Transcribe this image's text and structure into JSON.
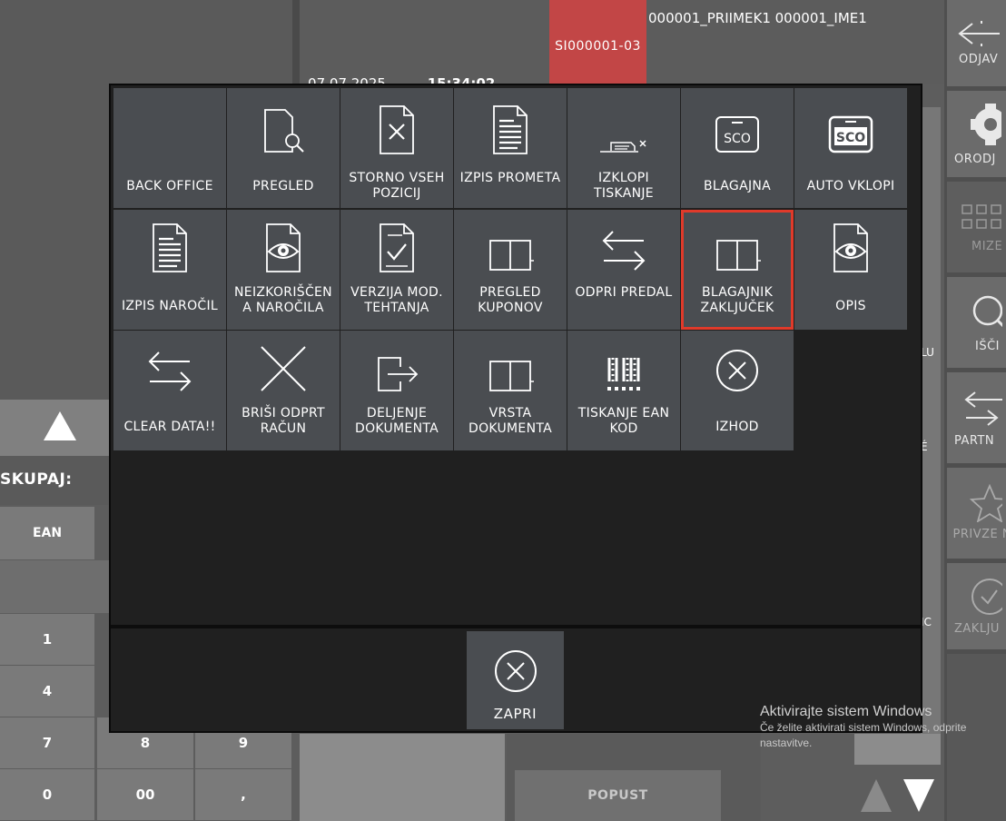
{
  "header": {
    "document_number": "SI000001-03",
    "customer": "000001_PRIIMEK1 000001_IME1",
    "date_partial": "07.07.2025",
    "time_partial": "15:34:02"
  },
  "sidebar_right": [
    {
      "label": "ODJAV",
      "icon": "logout-icon"
    },
    {
      "label": "ORODJ",
      "icon": "gear-icon"
    },
    {
      "label": "MIZE",
      "icon": "grid-icon"
    },
    {
      "label": "IŠČI",
      "icon": "search-icon"
    },
    {
      "label": "PARTN",
      "icon": "swap-arrows-icon"
    },
    {
      "label": "PRIVZE NP",
      "icon": "star-icon"
    },
    {
      "label": "ZAKLJU",
      "icon": "check-circle-icon"
    }
  ],
  "left_panel": {
    "total_label": "SKUPAJ:",
    "ean_label": "EAN",
    "numpad": [
      "1",
      "4",
      "7",
      "8",
      "9",
      "0",
      "00",
      ","
    ]
  },
  "bottom": {
    "discount_label": "POPUST"
  },
  "partial_side_labels": [
    "LU",
    "É",
    "IC"
  ],
  "modal": {
    "tiles": [
      {
        "label": "BACK OFFICE",
        "icon": "none"
      },
      {
        "label": "PREGLED",
        "icon": "document-search-icon"
      },
      {
        "label": "STORNO VSEH POZICIJ",
        "icon": "document-cancel-icon"
      },
      {
        "label": "IZPIS PROMETA",
        "icon": "document-lines-icon"
      },
      {
        "label": "IZKLOPI TISKANJE",
        "icon": "printer-off-icon"
      },
      {
        "label": "BLAGAJNA",
        "icon": "sco-icon"
      },
      {
        "label": "AUTO VKLOPI",
        "icon": "sco-bold-icon"
      },
      {
        "label": "IZPIS NAROČIL",
        "icon": "document-lines-icon"
      },
      {
        "label": "NEIZKORIŠČEN A NAROČILA",
        "icon": "document-eye-icon"
      },
      {
        "label": "VERZIJA MOD. TEHTANJA",
        "icon": "document-check-icon"
      },
      {
        "label": "PREGLED KUPONOV",
        "icon": "drawer-icon"
      },
      {
        "label": "ODPRI PREDAL",
        "icon": "swap-arrows-icon"
      },
      {
        "label": "BLAGAJNIK ZAKLJUČEK",
        "icon": "drawer-icon"
      },
      {
        "label": "OPIS",
        "icon": "document-eye-icon"
      },
      {
        "label": "CLEAR DATA!!",
        "icon": "swap-arrows-icon"
      },
      {
        "label": "BRIŠI ODPRT RAČUN",
        "icon": "cross-icon"
      },
      {
        "label": "DELJENJE DOKUMENTA",
        "icon": "export-icon"
      },
      {
        "label": "VRSTA DOKUMENTA",
        "icon": "drawer-icon"
      },
      {
        "label": "TISKANJE EAN KOD",
        "icon": "barcode-icon"
      },
      {
        "label": "IZHOD",
        "icon": "close-circle-icon"
      }
    ],
    "close_label": "ZAPRI"
  },
  "windows_notice": {
    "title": "Aktivirajte sistem Windows",
    "subtitle": "Če želite aktivirati sistem Windows, odprite nastavitve."
  },
  "colors": {
    "accent_red": "#c24646",
    "selected_outline": "#e03a2a",
    "tile": "#4a4d51",
    "modal_bg": "#202020"
  }
}
